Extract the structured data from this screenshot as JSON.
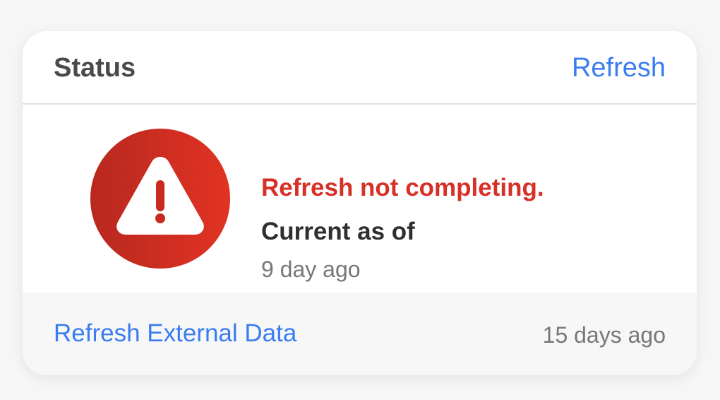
{
  "header": {
    "title": "Status",
    "refresh_label": "Refresh"
  },
  "status": {
    "icon": "warning-triangle-icon",
    "error_text": "Refresh not completing.",
    "current_label": "Current as of",
    "current_time": "9 day ago"
  },
  "footer": {
    "link_label": "Refresh External Data",
    "time": "15 days ago"
  },
  "colors": {
    "accent": "#3a7df0",
    "error": "#d63027",
    "alert_gradient_start": "#b8281f",
    "alert_gradient_end": "#e13323"
  }
}
